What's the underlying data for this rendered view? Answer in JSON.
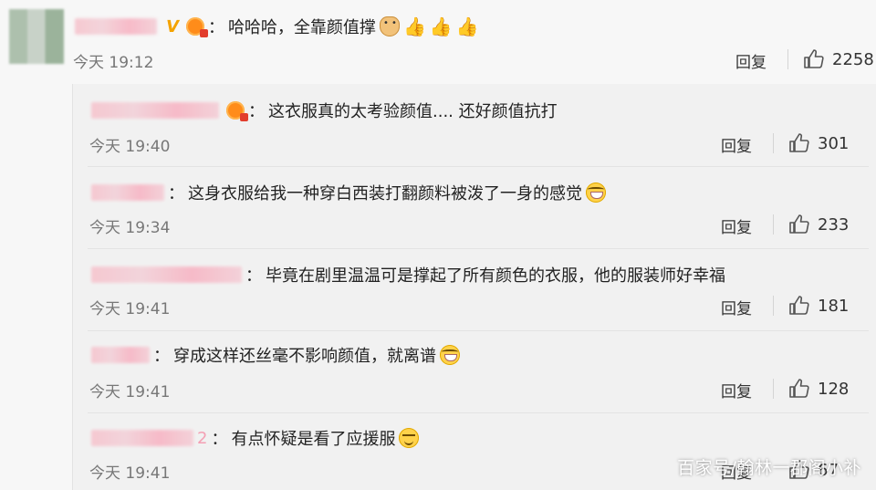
{
  "main": {
    "separator": "：",
    "text": "哈哈哈，全靠颜值撑",
    "time": "今天 19:12",
    "reply": "回复",
    "likes": "2258",
    "emojis": [
      "doge-emoji",
      "thumbs-up-emoji",
      "thumbs-up-emoji",
      "thumbs-up-emoji"
    ]
  },
  "replies": [
    {
      "text": "这衣服真的太考验颜值....  还好颜值抗打",
      "time": "今天 19:40",
      "reply": "回复",
      "likes": "301",
      "name_suffix": ""
    },
    {
      "text": "这身衣服给我一种穿白西装打翻颜料被泼了一身的感觉",
      "time": "今天 19:34",
      "reply": "回复",
      "likes": "233",
      "name_suffix": ""
    },
    {
      "text": "毕竟在剧里温温可是撑起了所有颜色的衣服，他的服装师好幸福",
      "time": "今天 19:41",
      "reply": "回复",
      "likes": "181",
      "name_suffix": ""
    },
    {
      "text": "穿成这样还丝毫不影响颜值，就离谱",
      "time": "今天 19:41",
      "reply": "回复",
      "likes": "128",
      "name_suffix": ""
    },
    {
      "text": "有点怀疑是看了应援服",
      "time": "今天 19:41",
      "reply": "回复",
      "likes": "67",
      "name_suffix": "2"
    }
  ],
  "separator": "：",
  "watermark": "百家号/翰林一郡阁小补",
  "colors": {
    "background": "#f7f7f7",
    "sub_panel": "#f1f1f1",
    "text": "#222222",
    "meta": "#777777"
  }
}
